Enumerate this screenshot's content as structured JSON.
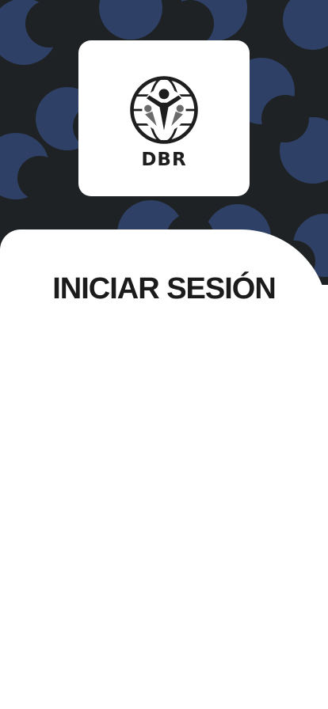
{
  "brand": {
    "logo_text": "DBR",
    "emblem_icon": "globe-figures-emblem-icon"
  },
  "login": {
    "title": "INICIAR SESIÓN"
  },
  "colors": {
    "header_bg": "#1f2224",
    "circle_pattern": "#2f4066",
    "card_bg": "#ffffff",
    "title_text": "#1b1b1b"
  }
}
